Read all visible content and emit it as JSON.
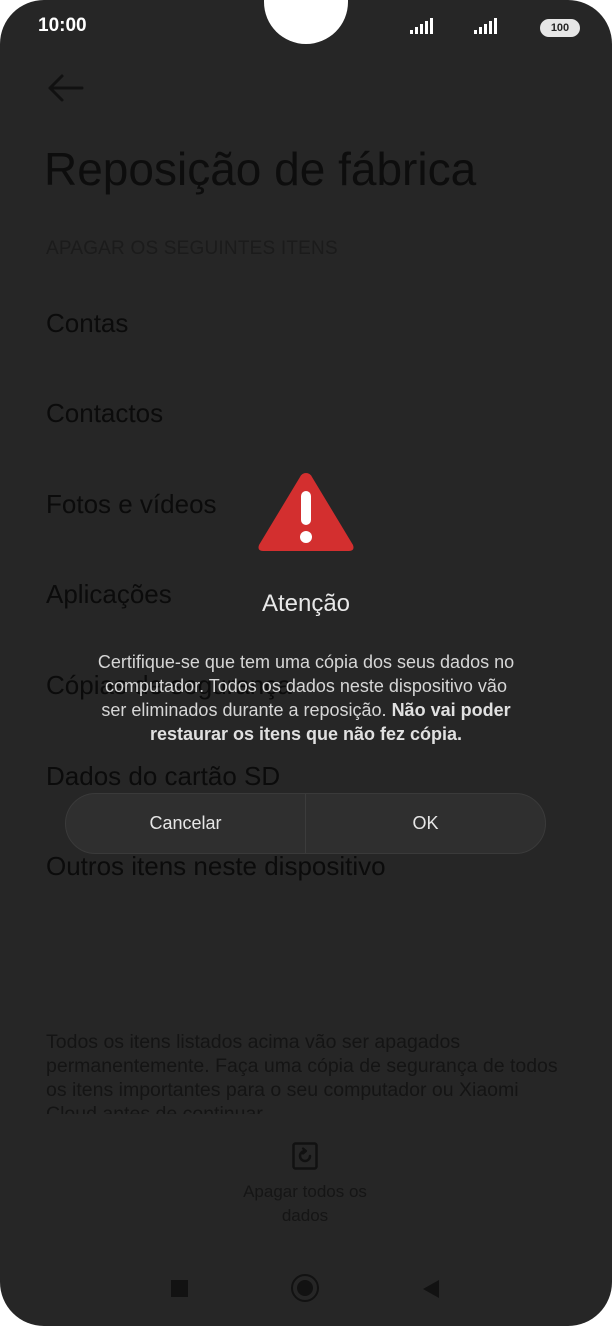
{
  "status_bar": {
    "time": "10:00",
    "battery": "100"
  },
  "header": {
    "title": "Reposição de fábrica"
  },
  "section": {
    "label": "APAGAR OS SEGUINTES ITENS"
  },
  "items": [
    {
      "label": "Contas"
    },
    {
      "label": "Contactos"
    },
    {
      "label": "Fotos e vídeos"
    },
    {
      "label": "Aplicações"
    },
    {
      "label": "Cópias de segurança"
    },
    {
      "label": "Dados do cartão SD"
    },
    {
      "label": "Outros itens neste dispositivo"
    }
  ],
  "footnote": "Todos os itens listados acima vão ser apagados permanentemente. Faça uma cópia de segurança de todos os itens importantes para o seu computador ou Xiaomi Cloud antes de continuar.",
  "action": {
    "erase_line1": "Apagar todos os",
    "erase_line2": "dados",
    "icon": "erase-icon"
  },
  "dialog": {
    "title": "Atenção",
    "body_line1": "Certifique-se que tem uma cópia dos seus dados no",
    "body_line2": "computador. Todos os dados neste dispositivo vão",
    "body_line3a": "ser eliminados durante a reposição. ",
    "body_line3b": "Não vai poder",
    "body_line4": "restaurar os itens que não fez cópia.",
    "cancel_label": "Cancelar",
    "ok_label": "OK",
    "icon_color": "#d32f2f"
  },
  "colors": {
    "background": "#262626",
    "accent_warning": "#d32f2f"
  }
}
